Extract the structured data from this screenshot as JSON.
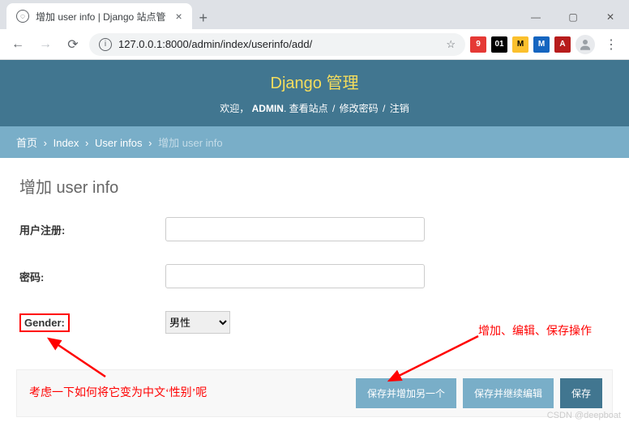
{
  "window": {
    "tab_title": "增加 user info | Django 站点管",
    "url": "127.0.0.1:8000/admin/index/userinfo/add/"
  },
  "ext": {
    "e1": "9",
    "e2": "01",
    "e3": "M",
    "e4": "M",
    "e5": "A"
  },
  "header": {
    "title": "Django 管理",
    "welcome": "欢迎，",
    "user": "ADMIN",
    "view_site": "查看站点",
    "change_password": "修改密码",
    "logout": "注销"
  },
  "breadcrumbs": {
    "home": "首页",
    "app": "Index",
    "model": "User infos",
    "current": "增加 user info"
  },
  "page": {
    "title": "增加 user info"
  },
  "form": {
    "username_label": "用户注册:",
    "password_label": "密码:",
    "gender_label": "Gender:",
    "gender_value": "男性"
  },
  "buttons": {
    "save_add_another": "保存并增加另一个",
    "save_continue": "保存并继续编辑",
    "save": "保存"
  },
  "annotations": {
    "left": "考虑一下如何将它变为中文‘性别’呢",
    "right": "增加、编辑、保存操作"
  },
  "watermark": "CSDN @deepboat"
}
